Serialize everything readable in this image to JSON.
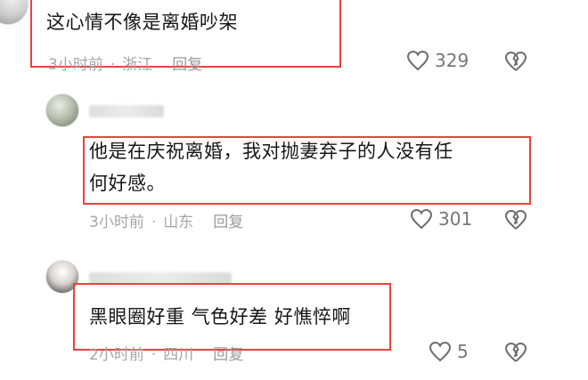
{
  "comments": [
    {
      "text": "这心情不像是离婚吵架",
      "time": "3小时前",
      "location": "浙江",
      "reply_label": "回复",
      "likes": "329"
    },
    {
      "text_line1": "他是在庆祝离婚，我对抛妻弃子的人没有任",
      "text_line2": "何好感。",
      "time": "3小时前",
      "location": "山东",
      "reply_label": "回复",
      "likes": "301"
    },
    {
      "text": "黑眼圈好重 气色好差 好憔悴啊",
      "time": "2小时前",
      "location": "四川",
      "reply_label": "回复",
      "likes": "5"
    }
  ],
  "colors": {
    "highlight": "#e8443c",
    "meta_text": "#a6a6a6",
    "body_text": "#161616"
  }
}
